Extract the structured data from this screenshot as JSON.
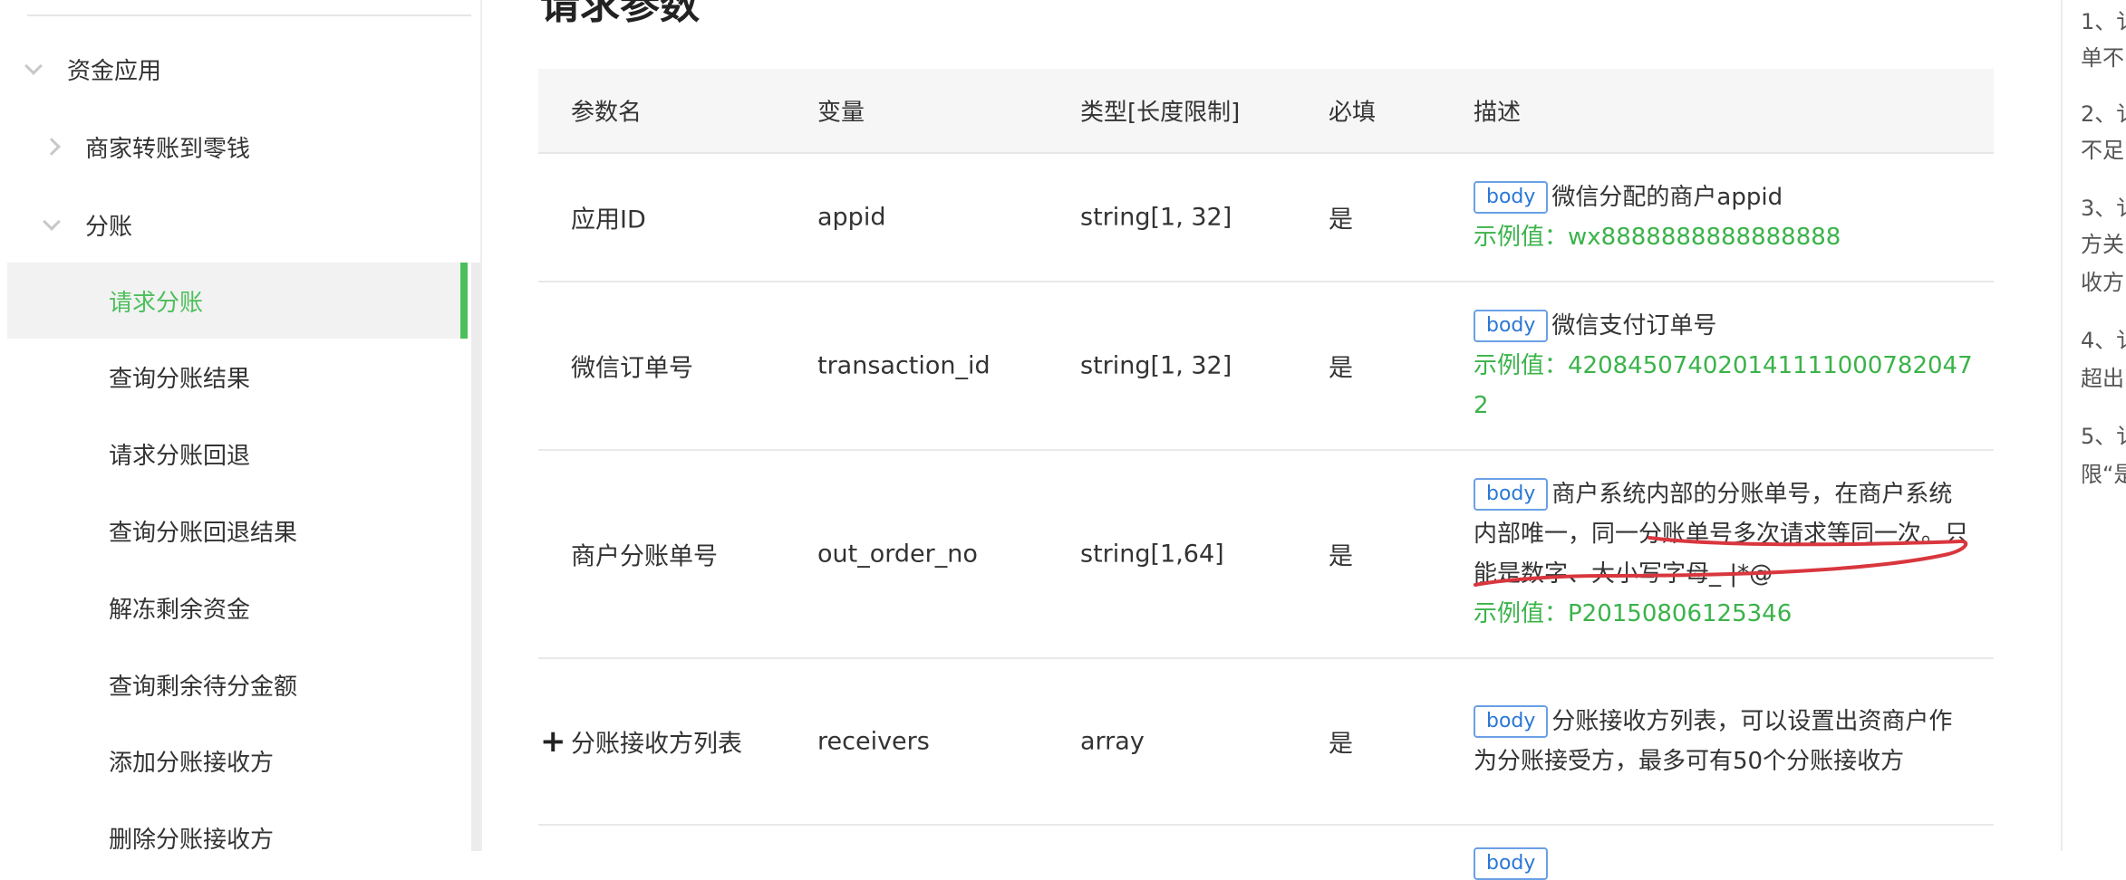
{
  "sidebar": {
    "items": [
      {
        "label": "资金应用"
      },
      {
        "label": "商家转账到零钱"
      },
      {
        "label": "分账"
      },
      {
        "label": "请求分账"
      },
      {
        "label": "查询分账结果"
      },
      {
        "label": "请求分账回退"
      },
      {
        "label": "查询分账回退结果"
      },
      {
        "label": "解冻剩余资金"
      },
      {
        "label": "查询剩余待分金额"
      },
      {
        "label": "添加分账接收方"
      },
      {
        "label": "删除分账接收方"
      }
    ],
    "active_color": "#4cbf5b"
  },
  "main": {
    "title": "请求参数",
    "columns": [
      "参数名",
      "变量",
      "类型[长度限制]",
      "必填",
      "描述"
    ],
    "rows": [
      {
        "name": "应用ID",
        "variable": "appid",
        "type": "string[1, 32]",
        "required": "是",
        "badge": "body",
        "desc": "微信分配的商户appid",
        "example": "示例值：wx8888888888888888"
      },
      {
        "name": "微信订单号",
        "variable": "transaction_id",
        "type": "string[1, 32]",
        "required": "是",
        "badge": "body",
        "desc": "微信支付订单号",
        "example": "示例值：4208450740201411110007820472"
      },
      {
        "name": "商户分账单号",
        "variable": "out_order_no",
        "type": "string[1,64]",
        "required": "是",
        "badge": "body",
        "desc": "商户系统内部的分账单号，在商户系统内部唯一，同一分账单号多次请求等同一次。只能是数字、大小写字母_-|*@",
        "example": "示例值：P20150806125346"
      },
      {
        "name": "分账接收方列表",
        "variable": "receivers",
        "type": "array",
        "required": "是",
        "badge": "body",
        "desc": "分账接收方列表，可以设置出资商户作为分账接受方，最多可有50个分账接收方",
        "expand": "+"
      },
      {
        "badge": "body"
      }
    ]
  },
  "right_rail": {
    "lines": [
      "1、讠",
      "单不",
      "2、讠",
      "不足",
      "3、讠",
      "方关",
      "收方",
      "4、讠",
      "超出",
      "5、讠",
      "限“是"
    ]
  },
  "colors": {
    "accent": "#4cbf5b",
    "badge": "#2a78d6",
    "example": "#3bb34a",
    "annotation": "#d9363e"
  }
}
